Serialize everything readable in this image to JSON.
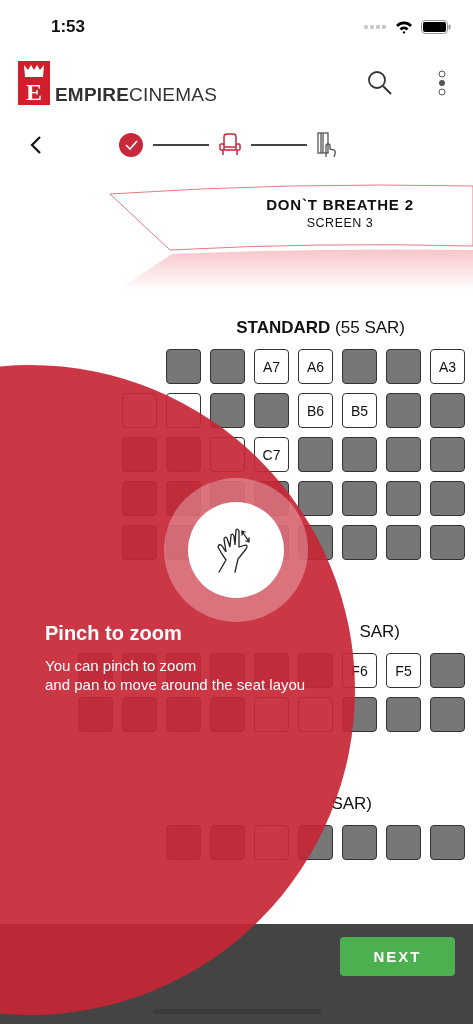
{
  "status_bar": {
    "time": "1:53"
  },
  "header": {
    "logo_mark": "E",
    "brand": "**EMPIRE**CINEMAS"
  },
  "steps": [
    {
      "kind": "done",
      "completed": true
    },
    {
      "kind": "seat",
      "active": true
    },
    {
      "kind": "payment",
      "active": false
    }
  ],
  "screen": {
    "title": "DON`T BREATHE 2",
    "subtitle": "SCREEN 3"
  },
  "sections": [
    {
      "heading": "**STANDARD** (55 SAR)",
      "rows": [
        {
          "seats": [
            {
              "kind": "gap"
            },
            {
              "kind": "gap"
            },
            {
              "kind": "taken"
            },
            {
              "kind": "taken"
            },
            {
              "kind": "free",
              "label": "A7"
            },
            {
              "kind": "free",
              "label": "A6"
            },
            {
              "kind": "taken"
            },
            {
              "kind": "taken"
            },
            {
              "kind": "free",
              "label": "A3"
            }
          ]
        },
        {
          "seats": [
            {
              "kind": "gap"
            },
            {
              "kind": "free"
            },
            {
              "kind": "free"
            },
            {
              "kind": "taken"
            },
            {
              "kind": "taken"
            },
            {
              "kind": "free",
              "label": "B6"
            },
            {
              "kind": "free",
              "label": "B5"
            },
            {
              "kind": "taken"
            },
            {
              "kind": "taken"
            }
          ]
        },
        {
          "seats": [
            {
              "kind": "gap"
            },
            {
              "kind": "taken"
            },
            {
              "kind": "taken"
            },
            {
              "kind": "free"
            },
            {
              "kind": "free",
              "label": "C7"
            },
            {
              "kind": "taken"
            },
            {
              "kind": "taken"
            },
            {
              "kind": "taken"
            },
            {
              "kind": "taken"
            }
          ]
        },
        {
          "seats": [
            {
              "kind": "gap"
            },
            {
              "kind": "taken"
            },
            {
              "kind": "taken"
            },
            {
              "kind": "taken"
            },
            {
              "kind": "taken"
            },
            {
              "kind": "taken"
            },
            {
              "kind": "taken"
            },
            {
              "kind": "taken"
            },
            {
              "kind": "taken"
            }
          ]
        },
        {
          "seats": [
            {
              "kind": "gap"
            },
            {
              "kind": "taken"
            },
            {
              "kind": "taken"
            },
            {
              "kind": "gap"
            },
            {
              "kind": "taken"
            },
            {
              "kind": "taken"
            },
            {
              "kind": "taken"
            },
            {
              "kind": "taken"
            },
            {
              "kind": "taken"
            }
          ]
        }
      ]
    },
    {
      "heading": "SAR)",
      "rows": [
        {
          "seats": [
            {
              "kind": "taken"
            },
            {
              "kind": "taken"
            },
            {
              "kind": "taken"
            },
            {
              "kind": "taken"
            },
            {
              "kind": "taken"
            },
            {
              "kind": "taken"
            },
            {
              "kind": "free",
              "label": "F6"
            },
            {
              "kind": "free",
              "label": "F5"
            },
            {
              "kind": "taken"
            }
          ]
        },
        {
          "seats": [
            {
              "kind": "taken"
            },
            {
              "kind": "taken"
            },
            {
              "kind": "taken"
            },
            {
              "kind": "taken"
            },
            {
              "kind": "free"
            },
            {
              "kind": "free"
            },
            {
              "kind": "taken"
            },
            {
              "kind": "taken"
            },
            {
              "kind": "taken"
            }
          ]
        }
      ]
    },
    {
      "heading": "SAR)",
      "rows": [
        {
          "seats": [
            {
              "kind": "gap"
            },
            {
              "kind": "gap"
            },
            {
              "kind": "taken"
            },
            {
              "kind": "taken"
            },
            {
              "kind": "free"
            },
            {
              "kind": "taken"
            },
            {
              "kind": "taken"
            },
            {
              "kind": "taken"
            },
            {
              "kind": "taken"
            }
          ]
        }
      ]
    }
  ],
  "footer": {
    "next": "NEXT"
  },
  "tutorial": {
    "title": "Pinch to zoom",
    "text": "You can pinch to zoom\nand pan to move around the seat layou"
  }
}
